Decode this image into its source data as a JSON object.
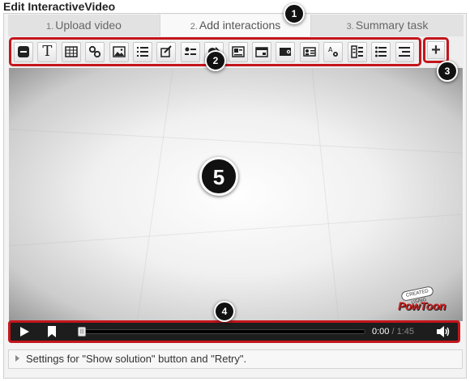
{
  "page": {
    "title": "Edit InteractiveVideo"
  },
  "tabs": [
    {
      "number": "1.",
      "label": "Upload video",
      "active": false
    },
    {
      "number": "2.",
      "label": "Add interactions",
      "active": true
    },
    {
      "number": "3.",
      "label": "Summary task",
      "active": false
    }
  ],
  "toolbar": {
    "buttons": [
      "stop-icon",
      "text-icon",
      "table-icon",
      "link-icon",
      "image-icon",
      "statements-icon",
      "single-choice-icon",
      "multiple-choice-icon",
      "true-false-icon",
      "fill-blanks-icon",
      "drag-drop-icon",
      "mark-words-icon",
      "drag-text-icon",
      "navigation-hotspot-icon",
      "questionnaire-icon",
      "list-icon",
      "more-icon"
    ],
    "plus_label": "+"
  },
  "video": {
    "watermark_top": "CREATED USING",
    "watermark_main": "PowToon"
  },
  "controls": {
    "current_time": "0:00",
    "separator": "/",
    "duration": "1:45",
    "progress": 0
  },
  "settings": {
    "label": "Settings for \"Show solution\" button and \"Retry\"."
  },
  "markers": [
    "1",
    "2",
    "3",
    "4",
    "5"
  ],
  "colors": {
    "highlight": "#c4151c",
    "marker": "#111111",
    "controls_bg": "#1d1d1d"
  }
}
